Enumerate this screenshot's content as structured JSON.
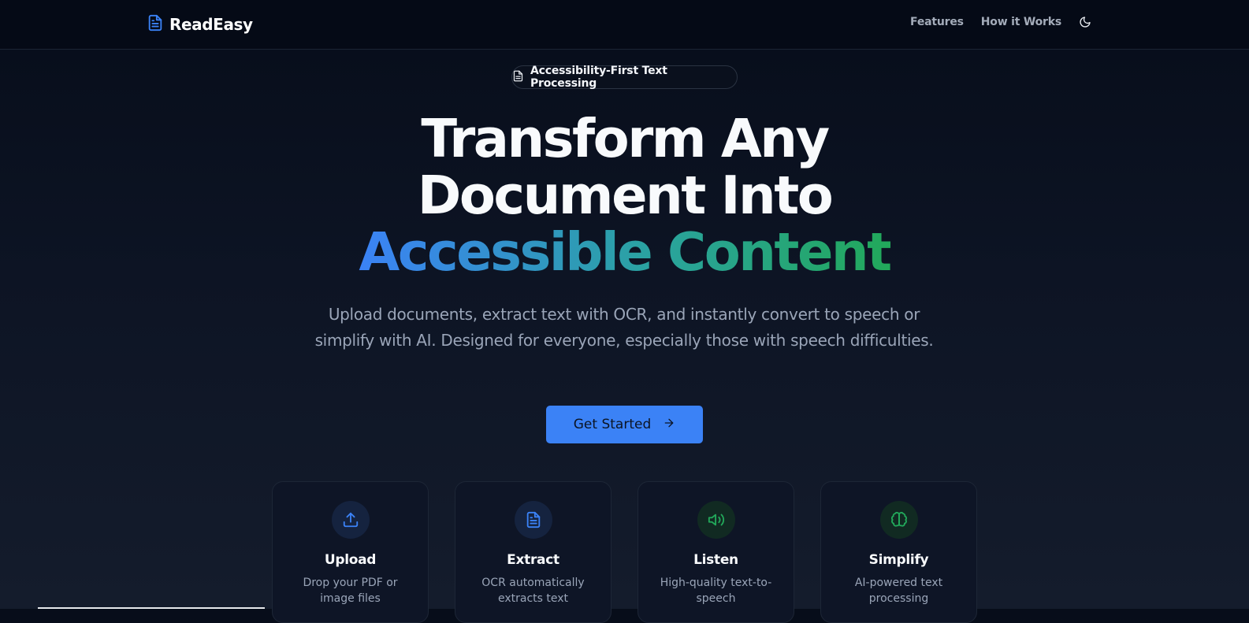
{
  "nav": {
    "brand": "ReadEasy",
    "links": [
      "Features",
      "How it Works"
    ],
    "brand_icon": "document-icon",
    "theme_icon": "moon-icon"
  },
  "badge": {
    "text": "Accessibility-First Text Processing",
    "icon": "document-icon"
  },
  "hero": {
    "title_line1": "Transform Any",
    "title_line2": "Document Into",
    "title_highlight": "Accessible Content",
    "subtitle": "Upload documents, extract text with OCR, and instantly convert to speech or simplify with AI. Designed for everyone, especially those with speech difficulties.",
    "cta_label": "Get Started",
    "cta_icon": "arrow-right-icon"
  },
  "features": [
    {
      "title": "Upload",
      "desc": "Drop your PDF or image files",
      "icon": "upload-icon"
    },
    {
      "title": "Extract",
      "desc": "OCR automatically extracts text",
      "icon": "document-icon"
    },
    {
      "title": "Listen",
      "desc": "High-quality text-to-speech",
      "icon": "speaker-icon"
    },
    {
      "title": "Simplify",
      "desc": "AI-powered text processing",
      "icon": "brain-icon"
    }
  ],
  "colors": {
    "accent_blue": "#3b82f6",
    "accent_green": "#22a85a",
    "background": "#0d1424",
    "text_muted": "#9aa5b8"
  }
}
